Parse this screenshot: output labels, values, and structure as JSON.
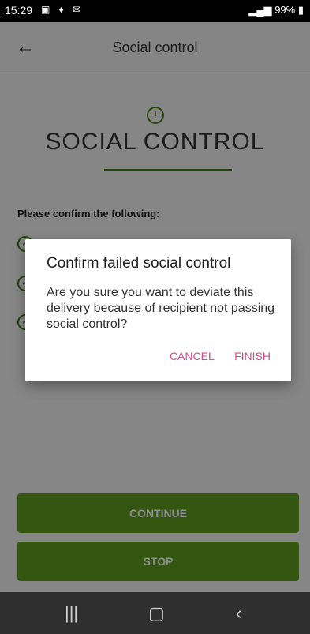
{
  "status_bar": {
    "time": "15:29",
    "battery": "99%"
  },
  "app_bar": {
    "title": "Social control"
  },
  "content": {
    "heading": "SOCIAL CONTROL",
    "confirm_label": "Please confirm the following:",
    "buttons": {
      "continue_label": "CONTINUE",
      "stop_label": "STOP"
    }
  },
  "dialog": {
    "title": "Confirm failed social control",
    "message": "Are you sure you want to deviate this delivery because of recipient not passing social control?",
    "cancel_label": "CANCEL",
    "finish_label": "FINISH"
  },
  "colors": {
    "accent_green": "#5d9e1f",
    "dialog_action": "#d9488f"
  },
  "icons": {
    "alert": "exclamation-circle-icon",
    "check": "check-circle-icon",
    "back": "arrow-left-icon"
  }
}
